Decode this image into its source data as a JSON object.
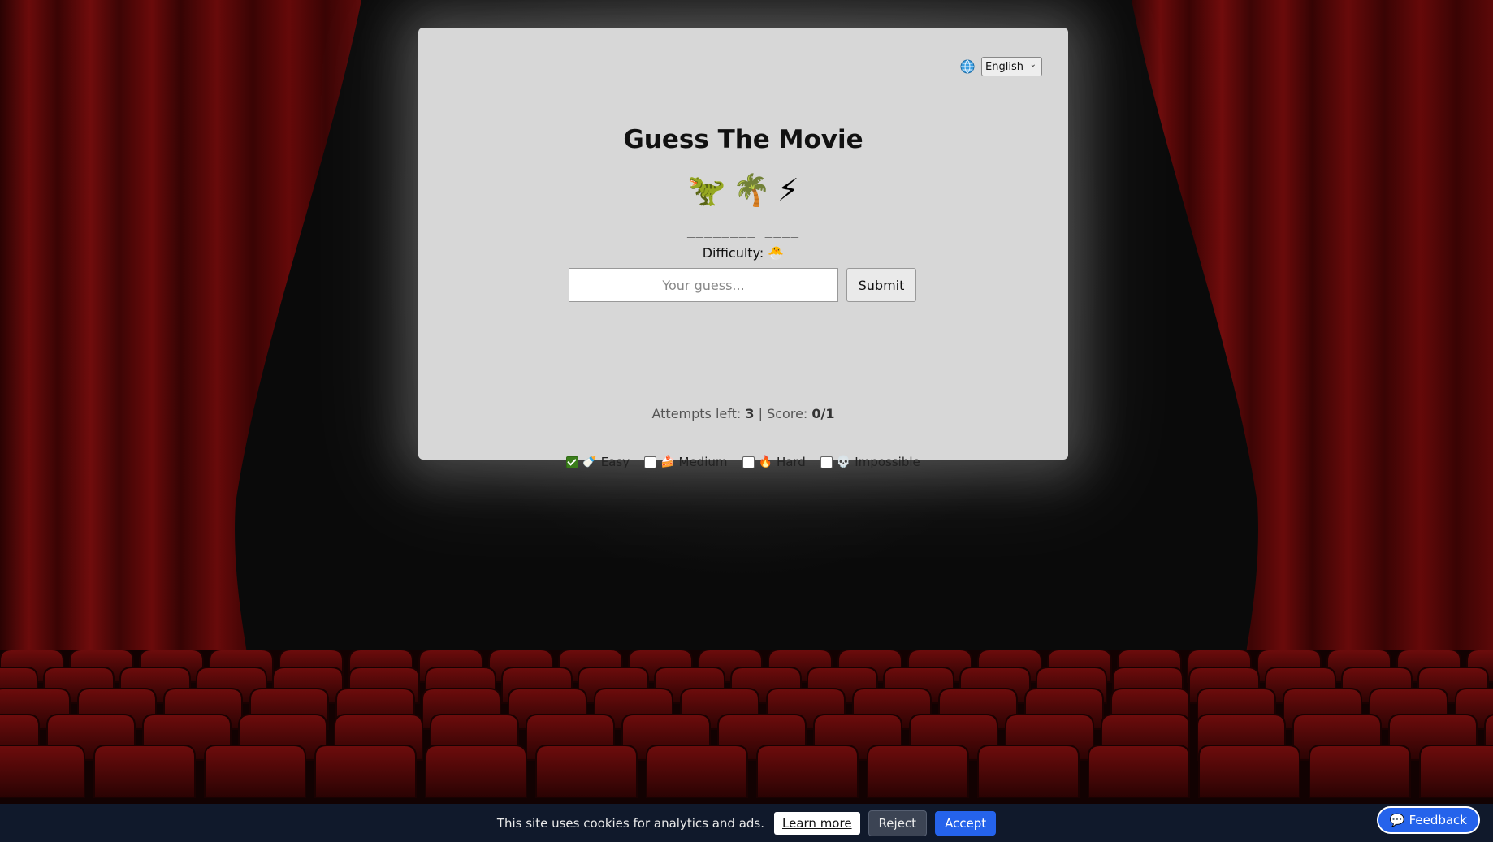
{
  "language": {
    "icon": "globe-icon",
    "selected": "English"
  },
  "game": {
    "title": "Guess The Movie",
    "emojis": [
      "🦖",
      "🌴",
      "⚡"
    ],
    "blanks": "________ ____",
    "difficulty_label": "Difficulty:",
    "difficulty_icon": "🐣"
  },
  "guess": {
    "placeholder": "Your guess...",
    "value": "",
    "submit_label": "Submit"
  },
  "stats": {
    "attempts_label": "Attempts left:",
    "attempts_value": "3",
    "separator": "|",
    "score_label": "Score:",
    "score_value": "0/1"
  },
  "levels": [
    {
      "emoji": "🍼",
      "label": "Easy",
      "checked": true
    },
    {
      "emoji": "🍰",
      "label": "Medium",
      "checked": false
    },
    {
      "emoji": "🔥",
      "label": "Hard",
      "checked": false
    },
    {
      "emoji": "💀",
      "label": "Impossible",
      "checked": false
    }
  ],
  "cookie": {
    "message": "This site uses cookies for analytics and ads.",
    "learn_more": "Learn more",
    "reject": "Reject",
    "accept": "Accept"
  },
  "feedback": {
    "icon": "💬",
    "label": "Feedback"
  },
  "colors": {
    "card_bg": "#d7d7d7",
    "curtain": "#5a0a0a",
    "accept": "#2563eb",
    "cookie_bar": "#10192b",
    "checked": "#3a7d1a"
  }
}
